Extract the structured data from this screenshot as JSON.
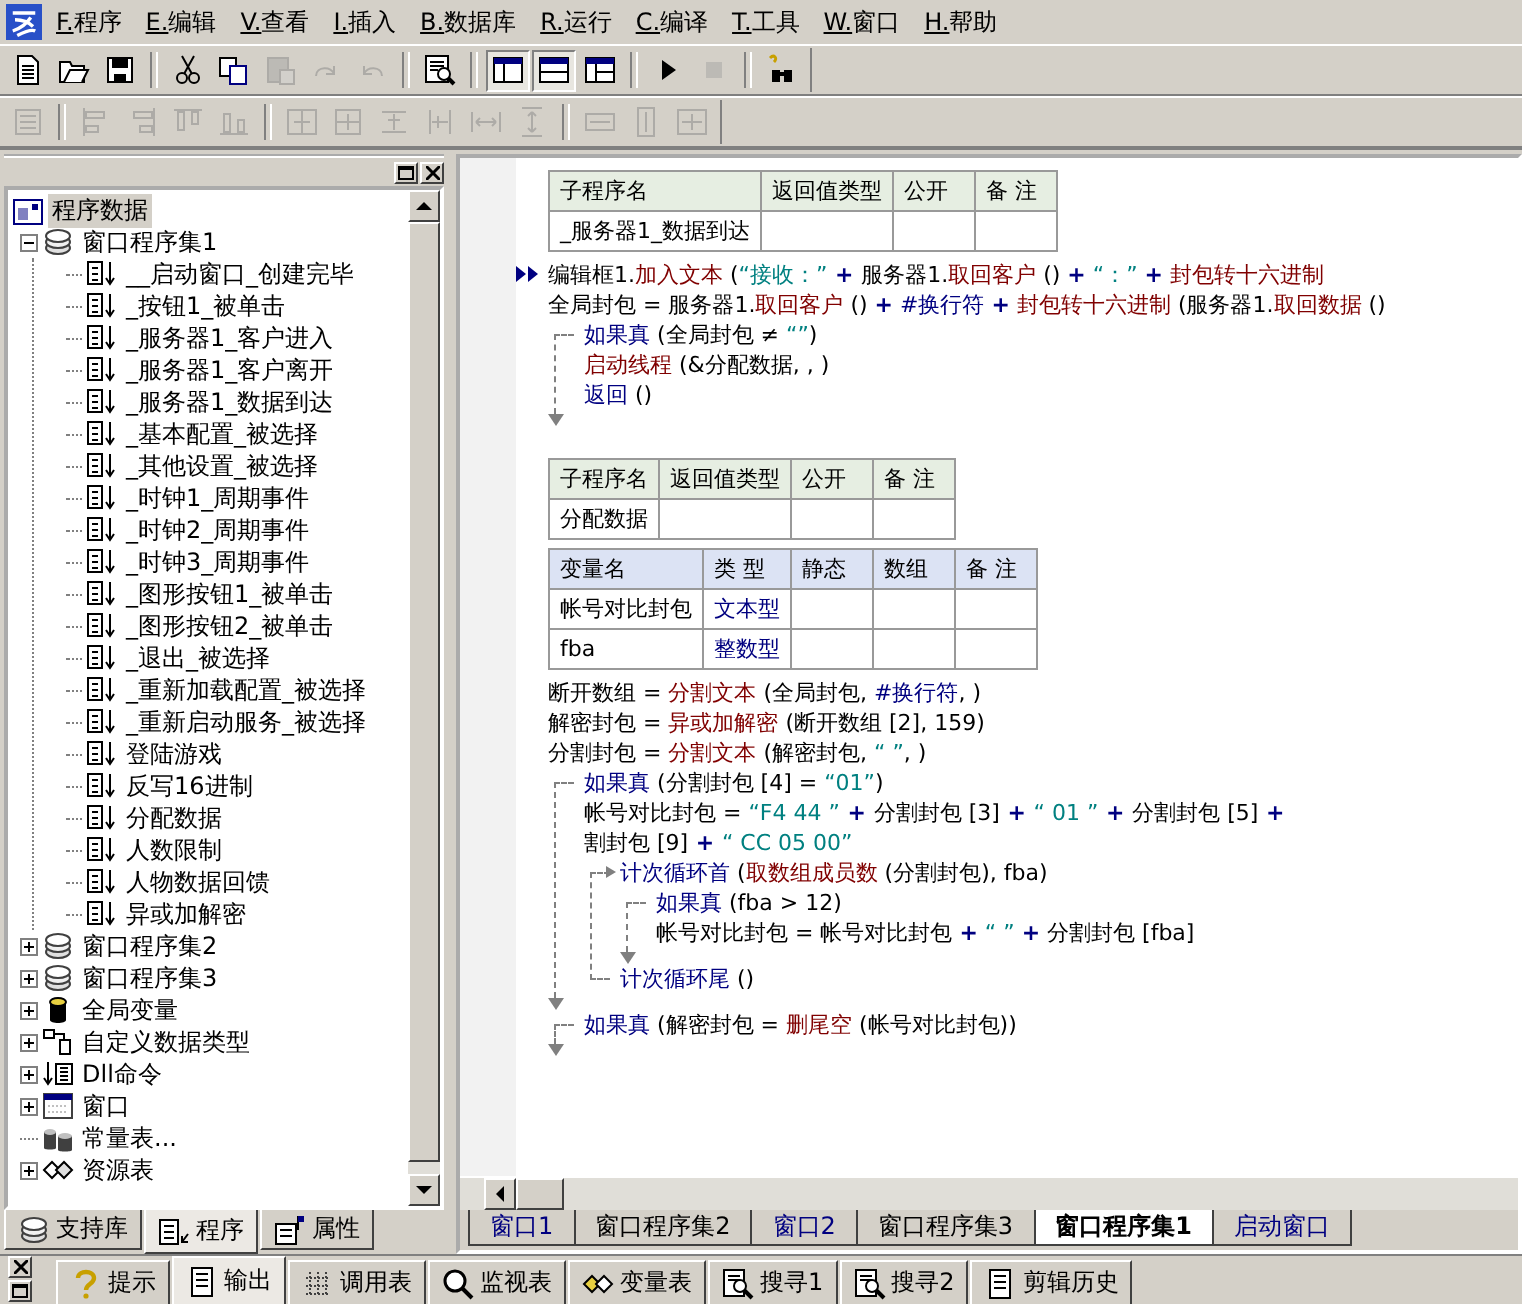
{
  "menu": [
    {
      "label": "F.程序"
    },
    {
      "label": "E.编辑"
    },
    {
      "label": "V.查看"
    },
    {
      "label": "I.插入"
    },
    {
      "label": "B.数据库"
    },
    {
      "label": "R.运行"
    },
    {
      "label": "C.编译"
    },
    {
      "label": "T.工具"
    },
    {
      "label": "W.窗口"
    },
    {
      "label": "H.帮助"
    }
  ],
  "toolbar_1": [
    {
      "kind": "new",
      "disabled": false,
      "pressed": false
    },
    {
      "kind": "open",
      "disabled": false,
      "pressed": false
    },
    {
      "kind": "save",
      "disabled": false,
      "pressed": false
    },
    {
      "kind": "separator"
    },
    {
      "kind": "cut",
      "disabled": false,
      "pressed": false
    },
    {
      "kind": "copy",
      "disabled": false,
      "pressed": false
    },
    {
      "kind": "paste",
      "disabled": true,
      "pressed": false
    },
    {
      "kind": "redo",
      "disabled": true,
      "pressed": false
    },
    {
      "kind": "undo",
      "disabled": true,
      "pressed": false
    },
    {
      "kind": "separator"
    },
    {
      "kind": "preview",
      "disabled": false,
      "pressed": false
    },
    {
      "kind": "separator"
    },
    {
      "kind": "layout-left",
      "disabled": false,
      "pressed": true
    },
    {
      "kind": "layout-top",
      "disabled": false,
      "pressed": true
    },
    {
      "kind": "layout-grid",
      "disabled": false,
      "pressed": false
    },
    {
      "kind": "separator"
    },
    {
      "kind": "run",
      "disabled": false,
      "pressed": false
    },
    {
      "kind": "stop",
      "disabled": true,
      "pressed": false
    },
    {
      "kind": "separator"
    },
    {
      "kind": "find",
      "disabled": false,
      "pressed": false
    }
  ],
  "toolbar_2": [
    {
      "kind": "form",
      "disabled": true
    },
    {
      "kind": "separator"
    },
    {
      "kind": "align-left",
      "disabled": true
    },
    {
      "kind": "align-right",
      "disabled": true
    },
    {
      "kind": "align-top",
      "disabled": true
    },
    {
      "kind": "align-bottom",
      "disabled": true
    },
    {
      "kind": "separator"
    },
    {
      "kind": "center-h",
      "disabled": true
    },
    {
      "kind": "center-v",
      "disabled": true
    },
    {
      "kind": "space-h",
      "disabled": true
    },
    {
      "kind": "space-v",
      "disabled": true
    },
    {
      "kind": "spread-h",
      "disabled": true
    },
    {
      "kind": "spread-v",
      "disabled": true
    },
    {
      "kind": "separator"
    },
    {
      "kind": "same-width",
      "disabled": true
    },
    {
      "kind": "same-height",
      "disabled": true
    },
    {
      "kind": "same-size",
      "disabled": true
    }
  ],
  "tree": {
    "label": "程序数据",
    "kind": "project",
    "selected": true,
    "children": [
      {
        "label": "窗口程序集1",
        "kind": "module",
        "expanded": true,
        "selected": false,
        "children": [
          {
            "label": "__启动窗口_创建完毕",
            "kind": "sub",
            "selected": false
          },
          {
            "label": "_按钮1_被单击",
            "kind": "sub",
            "selected": false
          },
          {
            "label": "_服务器1_客户进入",
            "kind": "sub",
            "selected": false
          },
          {
            "label": "_服务器1_客户离开",
            "kind": "sub",
            "selected": false
          },
          {
            "label": "_服务器1_数据到达",
            "kind": "sub",
            "selected": false
          },
          {
            "label": "_基本配置_被选择",
            "kind": "sub",
            "selected": false
          },
          {
            "label": "_其他设置_被选择",
            "kind": "sub",
            "selected": false
          },
          {
            "label": "_时钟1_周期事件",
            "kind": "sub",
            "selected": false
          },
          {
            "label": "_时钟2_周期事件",
            "kind": "sub",
            "selected": false
          },
          {
            "label": "_时钟3_周期事件",
            "kind": "sub",
            "selected": false
          },
          {
            "label": "_图形按钮1_被单击",
            "kind": "sub",
            "selected": false
          },
          {
            "label": "_图形按钮2_被单击",
            "kind": "sub",
            "selected": false
          },
          {
            "label": "_退出_被选择",
            "kind": "sub",
            "selected": false
          },
          {
            "label": "_重新加载配置_被选择",
            "kind": "sub",
            "selected": false
          },
          {
            "label": "_重新启动服务_被选择",
            "kind": "sub",
            "selected": false
          },
          {
            "label": "登陆游戏",
            "kind": "sub",
            "selected": false
          },
          {
            "label": "反写16进制",
            "kind": "sub",
            "selected": false
          },
          {
            "label": "分配数据",
            "kind": "sub",
            "selected": false
          },
          {
            "label": "人数限制",
            "kind": "sub",
            "selected": false
          },
          {
            "label": "人物数据回馈",
            "kind": "sub",
            "selected": false
          },
          {
            "label": "异或加解密",
            "kind": "sub",
            "selected": false
          }
        ]
      },
      {
        "label": "窗口程序集2",
        "kind": "module",
        "expanded": false,
        "selected": false
      },
      {
        "label": "窗口程序集3",
        "kind": "module",
        "expanded": false,
        "selected": false
      },
      {
        "label": "全局变量",
        "kind": "globals",
        "expanded": false,
        "selected": false
      },
      {
        "label": "自定义数据类型",
        "kind": "types",
        "expanded": false,
        "selected": false
      },
      {
        "label": "Dll命令",
        "kind": "dll",
        "expanded": false,
        "selected": false
      },
      {
        "label": "窗口",
        "kind": "window",
        "expanded": false,
        "selected": false
      },
      {
        "label": "常量表...",
        "kind": "consts",
        "selected": false
      },
      {
        "label": "资源表",
        "kind": "resources",
        "expanded": false,
        "selected": false
      }
    ]
  },
  "panel_tabs": [
    {
      "label": "支持库",
      "kind": "library",
      "selected": false
    },
    {
      "label": "程序",
      "kind": "program",
      "selected": true
    },
    {
      "label": "属性",
      "kind": "properties",
      "selected": false
    }
  ],
  "editor": {
    "blocks": [
      {
        "kind": "subroutine_table",
        "columns": [
          "子程序名",
          "返回值类型",
          "公开",
          "备 注"
        ],
        "rows": [
          [
            "_服务器1_数据到达",
            "",
            "",
            ""
          ]
        ]
      },
      {
        "kind": "line",
        "current": true,
        "segments": [
          {
            "kind": "plain",
            "text": "编辑框1."
          },
          {
            "kind": "function",
            "text": "加入文本"
          },
          {
            "kind": "plain",
            "text": " ("
          },
          {
            "kind": "string",
            "text": "“接收：”"
          },
          {
            "kind": "operator",
            "text": " + "
          },
          {
            "kind": "plain",
            "text": "服务器1."
          },
          {
            "kind": "function",
            "text": "取回客户"
          },
          {
            "kind": "plain",
            "text": " () "
          },
          {
            "kind": "operator",
            "text": "+"
          },
          {
            "kind": "string",
            "text": " “：” "
          },
          {
            "kind": "operator",
            "text": "+"
          },
          {
            "kind": "function",
            "text": " 封包转十六进制"
          }
        ]
      },
      {
        "kind": "line",
        "segments": [
          {
            "kind": "plain",
            "text": "全局封包 = 服务器1."
          },
          {
            "kind": "function",
            "text": "取回客户"
          },
          {
            "kind": "plain",
            "text": " () "
          },
          {
            "kind": "operator",
            "text": "+"
          },
          {
            "kind": "constant",
            "text": " #换行符 "
          },
          {
            "kind": "operator",
            "text": "+"
          },
          {
            "kind": "function",
            "text": " 封包转十六进制"
          },
          {
            "kind": "plain",
            "text": " (服务器1."
          },
          {
            "kind": "function",
            "text": "取回数据"
          },
          {
            "kind": "plain",
            "text": " ()"
          }
        ]
      },
      {
        "kind": "if",
        "head": [
          {
            "kind": "keyword",
            "text": "如果真"
          },
          {
            "kind": "plain",
            "text": " (全局封包 ≠ "
          },
          {
            "kind": "string",
            "text": "“”"
          },
          {
            "kind": "plain",
            "text": ")"
          }
        ],
        "children": [
          {
            "kind": "line",
            "segments": [
              {
                "kind": "function",
                "text": "启动线程"
              },
              {
                "kind": "plain",
                "text": " (&分配数据, , )"
              }
            ]
          },
          {
            "kind": "line",
            "segments": [
              {
                "kind": "keyword",
                "text": "返回"
              },
              {
                "kind": "plain",
                "text": " ()"
              }
            ]
          }
        ]
      },
      {
        "kind": "subroutine_table",
        "columns": [
          "子程序名",
          "返回值类型",
          "公开",
          "备 注"
        ],
        "rows": [
          [
            "分配数据",
            "",
            "",
            ""
          ]
        ]
      },
      {
        "kind": "variable_table",
        "columns": [
          "变量名",
          "类 型",
          "静态",
          "数组",
          "备 注"
        ],
        "rows": [
          [
            "帐号对比封包",
            "文本型",
            "",
            "",
            ""
          ],
          [
            "fba",
            "整数型",
            "",
            "",
            ""
          ]
        ]
      },
      {
        "kind": "line",
        "segments": [
          {
            "kind": "plain",
            "text": "断开数组 = "
          },
          {
            "kind": "function",
            "text": "分割文本"
          },
          {
            "kind": "plain",
            "text": " (全局封包, "
          },
          {
            "kind": "constant",
            "text": "#换行符"
          },
          {
            "kind": "plain",
            "text": ", )"
          }
        ]
      },
      {
        "kind": "line",
        "segments": [
          {
            "kind": "plain",
            "text": "解密封包 = "
          },
          {
            "kind": "function",
            "text": "异或加解密"
          },
          {
            "kind": "plain",
            "text": " (断开数组 [2], 159)"
          }
        ]
      },
      {
        "kind": "line",
        "segments": [
          {
            "kind": "plain",
            "text": "分割封包 = "
          },
          {
            "kind": "function",
            "text": "分割文本"
          },
          {
            "kind": "plain",
            "text": " (解密封包, "
          },
          {
            "kind": "string",
            "text": "“ ”"
          },
          {
            "kind": "plain",
            "text": ", )"
          }
        ]
      },
      {
        "kind": "if",
        "head": [
          {
            "kind": "keyword",
            "text": "如果真"
          },
          {
            "kind": "plain",
            "text": " (分割封包 [4] = "
          },
          {
            "kind": "string",
            "text": "“01”"
          },
          {
            "kind": "plain",
            "text": ")"
          }
        ],
        "children": [
          {
            "kind": "line",
            "segments": [
              {
                "kind": "plain",
                "text": "帐号对比封包 = "
              },
              {
                "kind": "string",
                "text": "“F4 44 ”"
              },
              {
                "kind": "operator",
                "text": " + "
              },
              {
                "kind": "plain",
                "text": "分割封包 [3]"
              },
              {
                "kind": "operator",
                "text": " + "
              },
              {
                "kind": "string",
                "text": "“ 01 ”"
              },
              {
                "kind": "operator",
                "text": " + "
              },
              {
                "kind": "plain",
                "text": "分割封包 [5]"
              },
              {
                "kind": "operator",
                "text": " + "
              }
            ]
          },
          {
            "kind": "line",
            "segments": [
              {
                "kind": "plain",
                "text": "割封包 [9]"
              },
              {
                "kind": "operator",
                "text": " + "
              },
              {
                "kind": "string",
                "text": "“ CC 05 00”"
              }
            ]
          },
          {
            "kind": "loop",
            "head": [
              {
                "kind": "keyword",
                "text": "计次循环首"
              },
              {
                "kind": "plain",
                "text": " ("
              },
              {
                "kind": "function",
                "text": "取数组成员数"
              },
              {
                "kind": "plain",
                "text": " (分割封包), fba)"
              }
            ],
            "tail": [
              {
                "kind": "keyword",
                "text": "计次循环尾"
              },
              {
                "kind": "plain",
                "text": " ()"
              }
            ],
            "children": [
              {
                "kind": "if",
                "head": [
                  {
                    "kind": "keyword",
                    "text": "如果真"
                  },
                  {
                    "kind": "plain",
                    "text": " (fba > 12)"
                  }
                ],
                "children": [
                  {
                    "kind": "line",
                    "segments": [
                      {
                        "kind": "plain",
                        "text": "帐号对比封包 = 帐号对比封包 "
                      },
                      {
                        "kind": "operator",
                        "text": "+"
                      },
                      {
                        "kind": "string",
                        "text": " “ ” "
                      },
                      {
                        "kind": "operator",
                        "text": "+"
                      },
                      {
                        "kind": "plain",
                        "text": " 分割封包 [fba]"
                      }
                    ]
                  }
                ]
              }
            ]
          }
        ]
      },
      {
        "kind": "if",
        "head": [
          {
            "kind": "keyword",
            "text": "如果真"
          },
          {
            "kind": "plain",
            "text": " (解密封包 = "
          },
          {
            "kind": "function",
            "text": "删尾空"
          },
          {
            "kind": "plain",
            "text": " (帐号对比封包))"
          }
        ]
      }
    ]
  },
  "window_tabs": [
    {
      "label": "窗口1",
      "kind": "window",
      "selected": false
    },
    {
      "label": "窗口程序集2",
      "kind": "module",
      "selected": false
    },
    {
      "label": "窗口2",
      "kind": "window",
      "selected": false
    },
    {
      "label": "窗口程序集3",
      "kind": "module",
      "selected": false
    },
    {
      "label": "窗口程序集1",
      "kind": "module",
      "selected": true
    },
    {
      "label": "启动窗口",
      "kind": "window",
      "selected": false
    }
  ],
  "bottom_tabs": [
    {
      "label": "提示",
      "kind": "hint",
      "selected": false
    },
    {
      "label": "输出",
      "kind": "output",
      "selected": true
    },
    {
      "label": "调用表",
      "kind": "calls",
      "selected": false
    },
    {
      "label": "监视表",
      "kind": "watch",
      "selected": false
    },
    {
      "label": "变量表",
      "kind": "variables",
      "selected": false
    },
    {
      "label": "搜寻1",
      "kind": "search",
      "selected": false
    },
    {
      "label": "搜寻2",
      "kind": "search",
      "selected": false
    },
    {
      "label": "剪辑历史",
      "kind": "clipboard",
      "selected": false
    }
  ]
}
